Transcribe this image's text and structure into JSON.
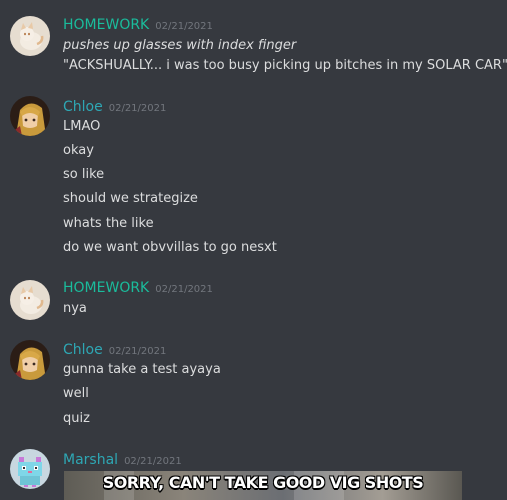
{
  "colors": {
    "background": "#36393f",
    "homework_name": "#1abc9c",
    "chloe_name": "#2ea7b4",
    "marshal_name": "#2ea7b4",
    "timestamp": "#72767d",
    "message_text": "#dcddde"
  },
  "messages": [
    {
      "author": "HOMEWORK",
      "timestamp": "02/21/2021",
      "avatar": "cat-avatar-icon",
      "lines": [
        "pushes up glasses with index finger",
        "\"ACKSHUALLY... i was too busy picking up bitches in my SOLAR CAR\""
      ]
    },
    {
      "author": "Chloe",
      "timestamp": "02/21/2021",
      "avatar": "anime-avatar-icon",
      "lines": [
        "LMAO",
        "okay",
        "so like",
        "should we strategize",
        "whats the like",
        "do we want obvvillas to go nesxt"
      ]
    },
    {
      "author": "HOMEWORK",
      "timestamp": "02/21/2021",
      "avatar": "cat-avatar-icon",
      "lines": [
        "nya"
      ]
    },
    {
      "author": "Chloe",
      "timestamp": "02/21/2021",
      "avatar": "anime-avatar-icon",
      "lines": [
        "gunna take a test ayaya",
        "well",
        "quiz"
      ]
    },
    {
      "author": "Marshal",
      "timestamp": "02/21/2021",
      "avatar": "pixel-cat-avatar-icon",
      "lines": [],
      "embed_caption": "SORRY, CAN'T TAKE GOOD VIG SHOTS"
    }
  ]
}
